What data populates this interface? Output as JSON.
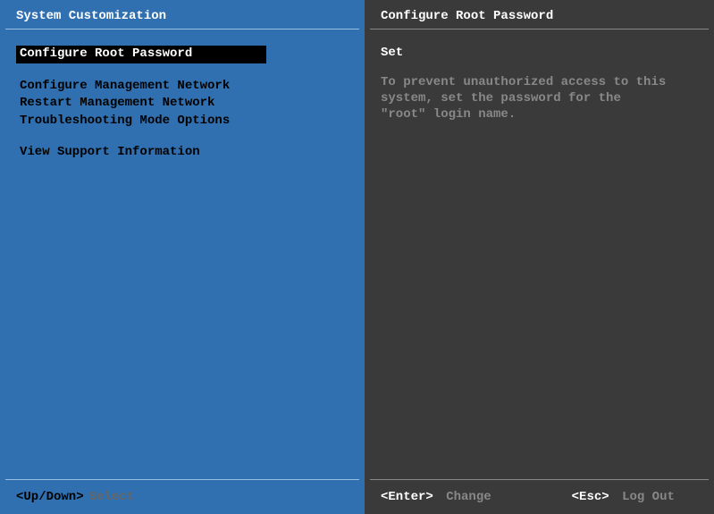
{
  "leftPanel": {
    "title": "System Customization",
    "menu": {
      "group1": [
        {
          "label": "Configure Root Password",
          "selected": true
        }
      ],
      "group2": [
        {
          "label": "Configure Management Network",
          "selected": false
        },
        {
          "label": "Restart Management Network",
          "selected": false
        },
        {
          "label": "Troubleshooting Mode Options",
          "selected": false
        }
      ],
      "group3": [
        {
          "label": "View Support Information",
          "selected": false
        }
      ]
    },
    "footer": {
      "key": "<Up/Down>",
      "action": "Select"
    }
  },
  "rightPanel": {
    "title": "Configure Root Password",
    "status": "Set",
    "description": "To prevent unauthorized access to this system, set the password for the \"root\" login name.",
    "footer": {
      "enter": {
        "key": "<Enter>",
        "action": "Change"
      },
      "esc": {
        "key": "<Esc>",
        "action": "Log Out"
      }
    }
  }
}
